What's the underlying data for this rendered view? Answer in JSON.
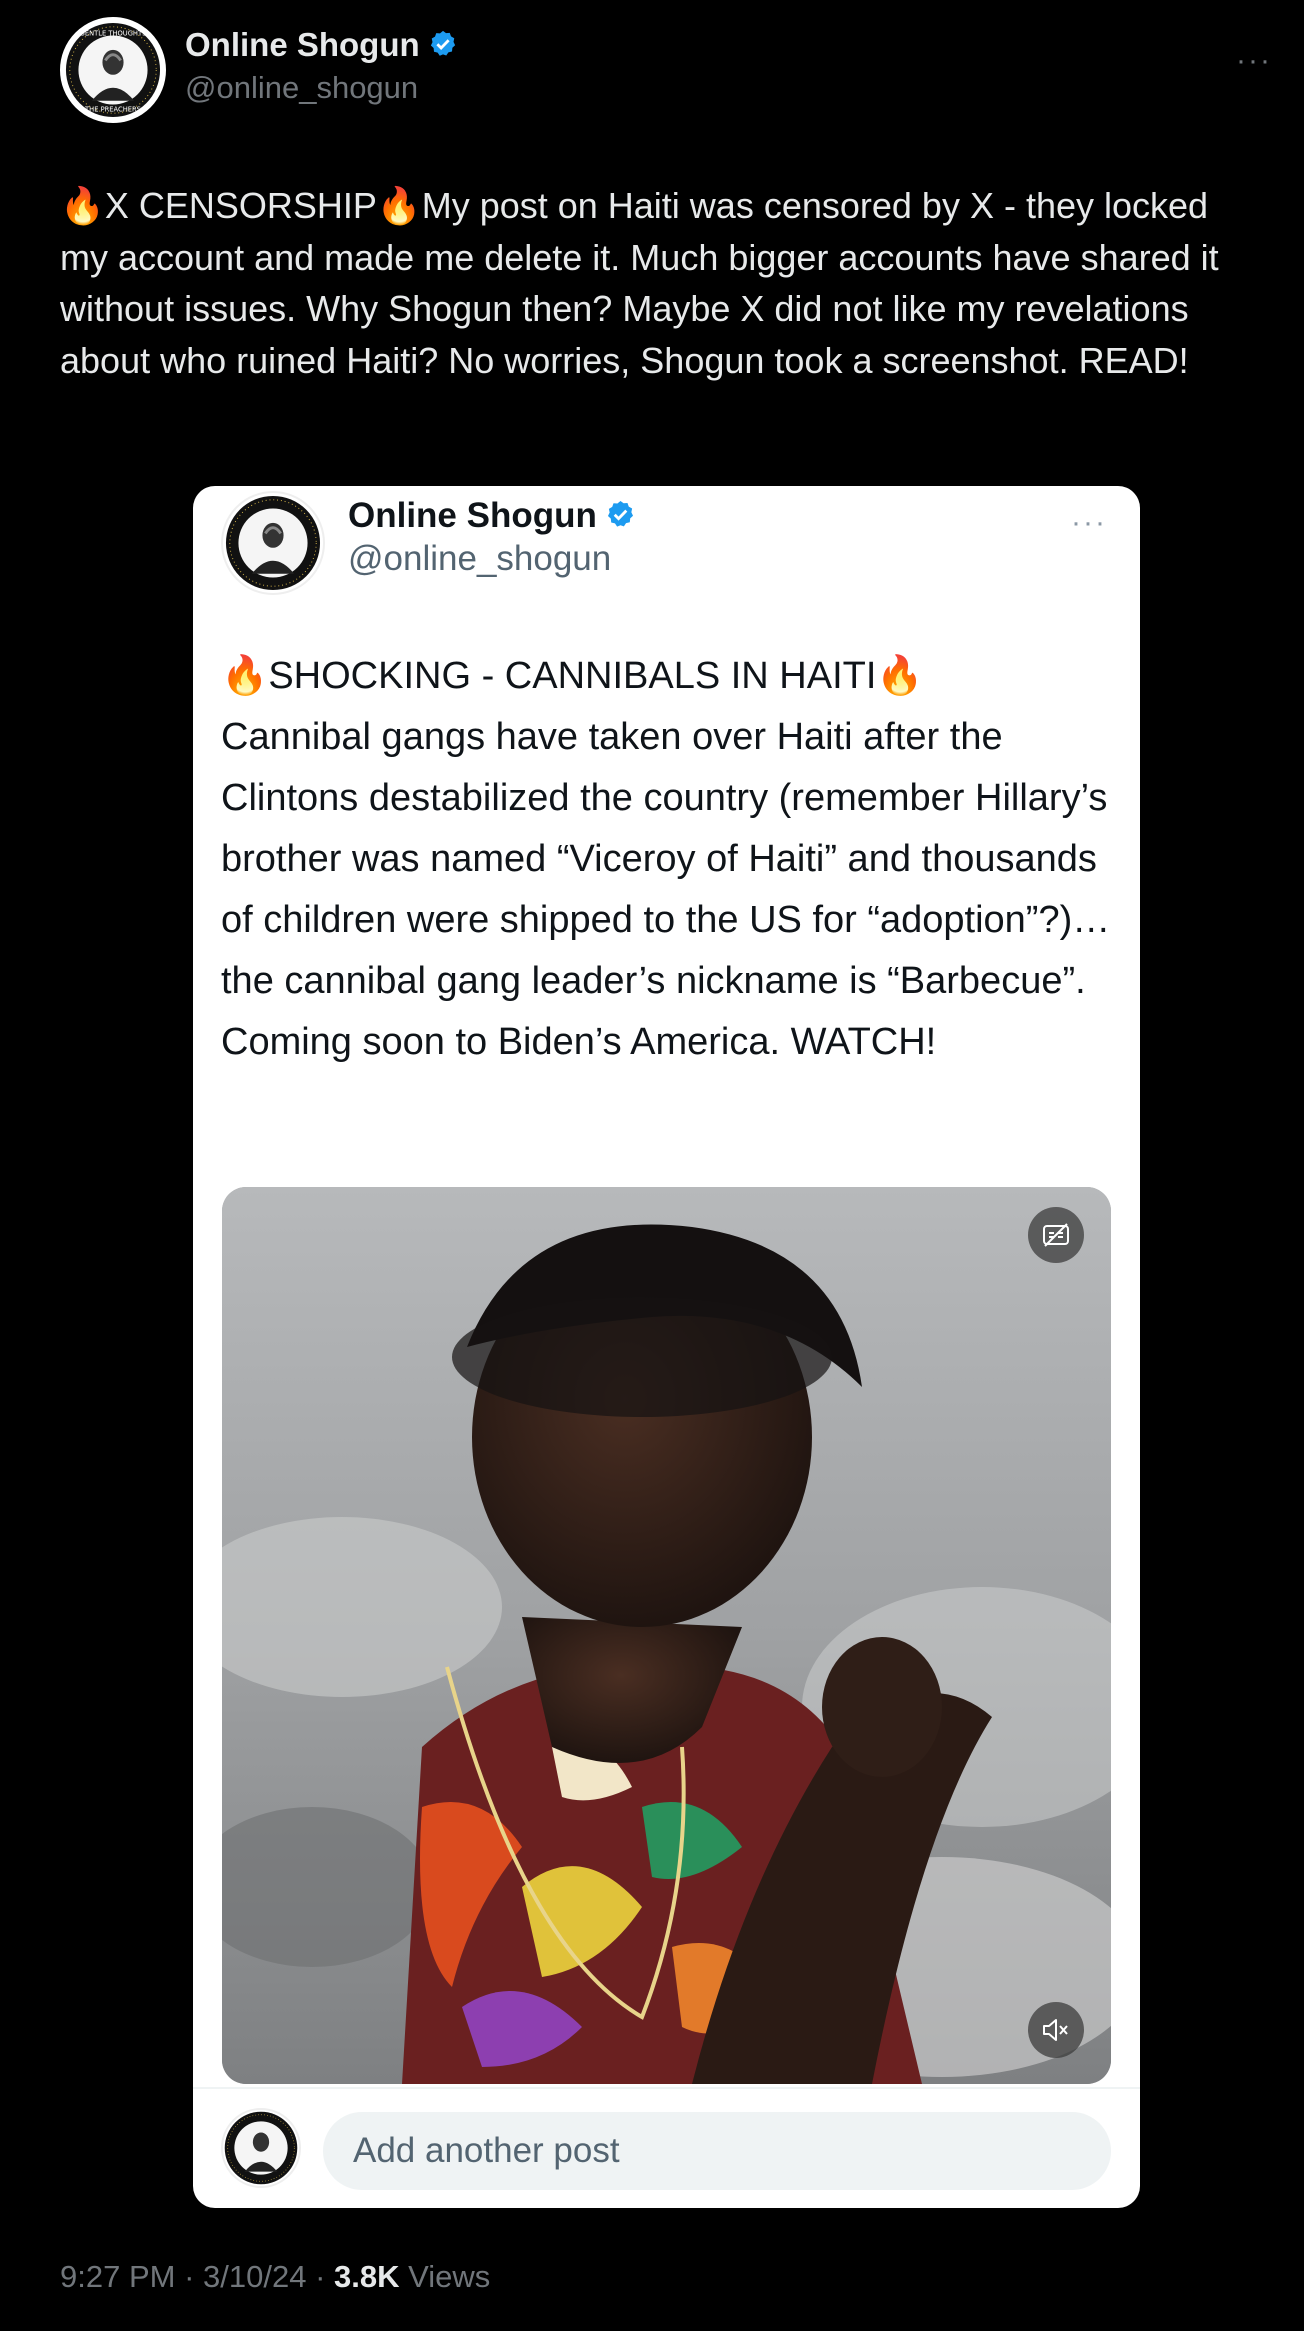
{
  "post": {
    "author_name": "Online Shogun",
    "author_handle": "@online_shogun",
    "more_label": "···",
    "text": "🔥X CENSORSHIP🔥My post on Haiti was censored by X - they locked my account and made me delete it. Much bigger accounts have shared it without issues. Why Shogun then? Maybe X did not like my revelations about who ruined Haiti? No worries, Shogun took a screenshot. READ!",
    "time": "9:27 PM",
    "date": "3/10/24",
    "sep": " · ",
    "views_count": "3.8K",
    "views_label": "Views"
  },
  "screenshot": {
    "author_name": "Online Shogun",
    "author_handle": "@online_shogun",
    "more_label": "···",
    "text": "🔥SHOCKING - CANNIBALS IN HAITI🔥\nCannibal gangs have taken over Haiti after the Clintons destabilized the country (remember Hillary’s brother was named “Viceroy of Haiti” and thousands of children were shipped to the US for “adoption”?)… the cannibal gang leader’s nickname is “Barbecue”. Coming soon to Biden’s America. WATCH!",
    "reply_placeholder": "Add another post"
  },
  "avatar": {
    "ring_text": "ƎNTIQ SSƎOTS · THE PREACHERS",
    "top_text": "GENTLE THOUGHTS",
    "bottom_text": "THE PREACHERS"
  },
  "icons": {
    "verified": "verified-badge-icon",
    "captions": "captions-off-icon",
    "mute": "muted-speaker-icon"
  },
  "colors": {
    "background": "#000000",
    "card": "#ffffff",
    "verified": "#1d9bf0",
    "muted_text": "#71767b",
    "text_light": "#e7e9ea"
  }
}
